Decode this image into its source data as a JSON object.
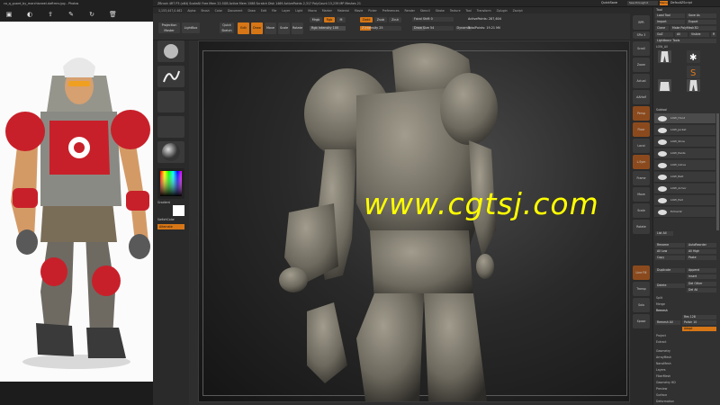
{
  "viewer": {
    "title": "co_q_guard_by_marchiorwel-daftmrv.jpg - Photos",
    "toolbar_icons": [
      "image-icon",
      "enhance-icon",
      "share-icon",
      "draw-icon",
      "rotate-icon",
      "delete-icon"
    ]
  },
  "zbrush": {
    "app_info": "ZBrush 4R7 P3 (x64)     ScaleAll     Free Mem 22.5GB   Active Mem 1588   Scratch Disk 1469   ActivePoints 2,317   PolyCount 15,239 MP   Meshes 21",
    "menus": [
      "Alpha",
      "Brush",
      "Color",
      "Document",
      "Draw",
      "Edit",
      "File",
      "Layer",
      "Light",
      "Macro",
      "Marker",
      "Material",
      "Movie",
      "Picker",
      "Preferences",
      "Render",
      "Stencil",
      "Stroke",
      "Texture",
      "Tool",
      "Transform",
      "Zplugin",
      "Zscript"
    ],
    "quicksave": "QuickSave",
    "seethrough": "See-through  0",
    "menus_btn": "Menus",
    "script_label": "DefaultZScript",
    "submenu_info": "1,153,447,0.462",
    "toolbar": {
      "projection_master": "Projection Master",
      "lightbox": "LightBox",
      "quick_sketch": "Quick Sketch",
      "edit": "Edit",
      "draw": "Draw",
      "move": "Move",
      "scale": "Scale",
      "rotate": "Rotate",
      "mrgb": "Mrgb",
      "rgb": "Rgb",
      "m": "M",
      "zadd": "Zadd",
      "zsub": "Zsub",
      "zcut": "Zcut",
      "rgb_intensity": "Rgb Intensity 100",
      "z_intensity": "Z Intensity 25",
      "focal_shift": "Focal Shift 0",
      "draw_size": "Draw Size 54",
      "dynamic": "Dynamic",
      "active_points": "ActivePoints: 287,604",
      "total_points": "TotalPoints: 19.21 Mil"
    },
    "left_shelf": {
      "gradient": "Gradient",
      "switch_color": "SwitchColor",
      "alternate": "Alternate"
    },
    "right_shelf": [
      "BPR",
      "SPix 3",
      "Scroll",
      "Zoom",
      "Actual",
      "AAHalf",
      "Persp",
      "Floor",
      "Local",
      "L.Sym",
      "Frame",
      "Move",
      "Scale",
      "Rotate",
      "Line Fill",
      "Transp",
      "Solo",
      "Xpose"
    ],
    "tray": {
      "title": "Tool",
      "load_tool": "Load Tool",
      "save_as": "Save As",
      "import": "Import",
      "export": "Export",
      "clone": "Clone",
      "make_polymesh": "Make PolyMesh3D",
      "goz": "GoZ",
      "all": "All",
      "visible": "Visible",
      "r": "R",
      "lightbox_tools": "Lightbox> Tools",
      "current_tool": "LOW_All",
      "tool_items": [
        "LOW_All",
        "PM3D_Sphere",
        "SimpleBrush",
        "PolyMesh3D",
        "Hoodie",
        "Pants_LOW"
      ],
      "subtool_title": "Subtool",
      "subtools": [
        "LOW_Hood",
        "LOW_Jacket",
        "LOW_Shoe",
        "LOW_Pants",
        "LOW_Glove",
        "LOW_Belt",
        "LOW_Armor",
        "LOW_Pad",
        "Extract2"
      ],
      "list_all": "List All",
      "rename": "Rename",
      "auto_reorder": "AutoReorder",
      "all_low": "All Low",
      "all_high": "All High",
      "copy": "Copy",
      "paste": "Paste",
      "duplicate": "Duplicate",
      "append": "Append",
      "insert": "Insert",
      "delete": "Delete",
      "del_other": "Del Other",
      "del_all": "Del All",
      "split": "Split",
      "merge": "Merge",
      "remesh": "Remesh",
      "remesh_all": "Remesh All",
      "res": "Res 128",
      "polish": "Polish 10",
      "adapt": "Adapt",
      "project": "Project",
      "extract": "Extract",
      "sections": [
        "Geometry",
        "ArrayMesh",
        "NanoMesh",
        "Layers",
        "FiberMesh",
        "Geometry HD",
        "Preview",
        "Surface",
        "Deformation"
      ]
    }
  },
  "watermark": "www.cgtsj.com",
  "colors": {
    "accent": "#d67616",
    "watermark": "#ffff00",
    "panel": "#313131",
    "viewport_bg": "#1a1a1a"
  }
}
